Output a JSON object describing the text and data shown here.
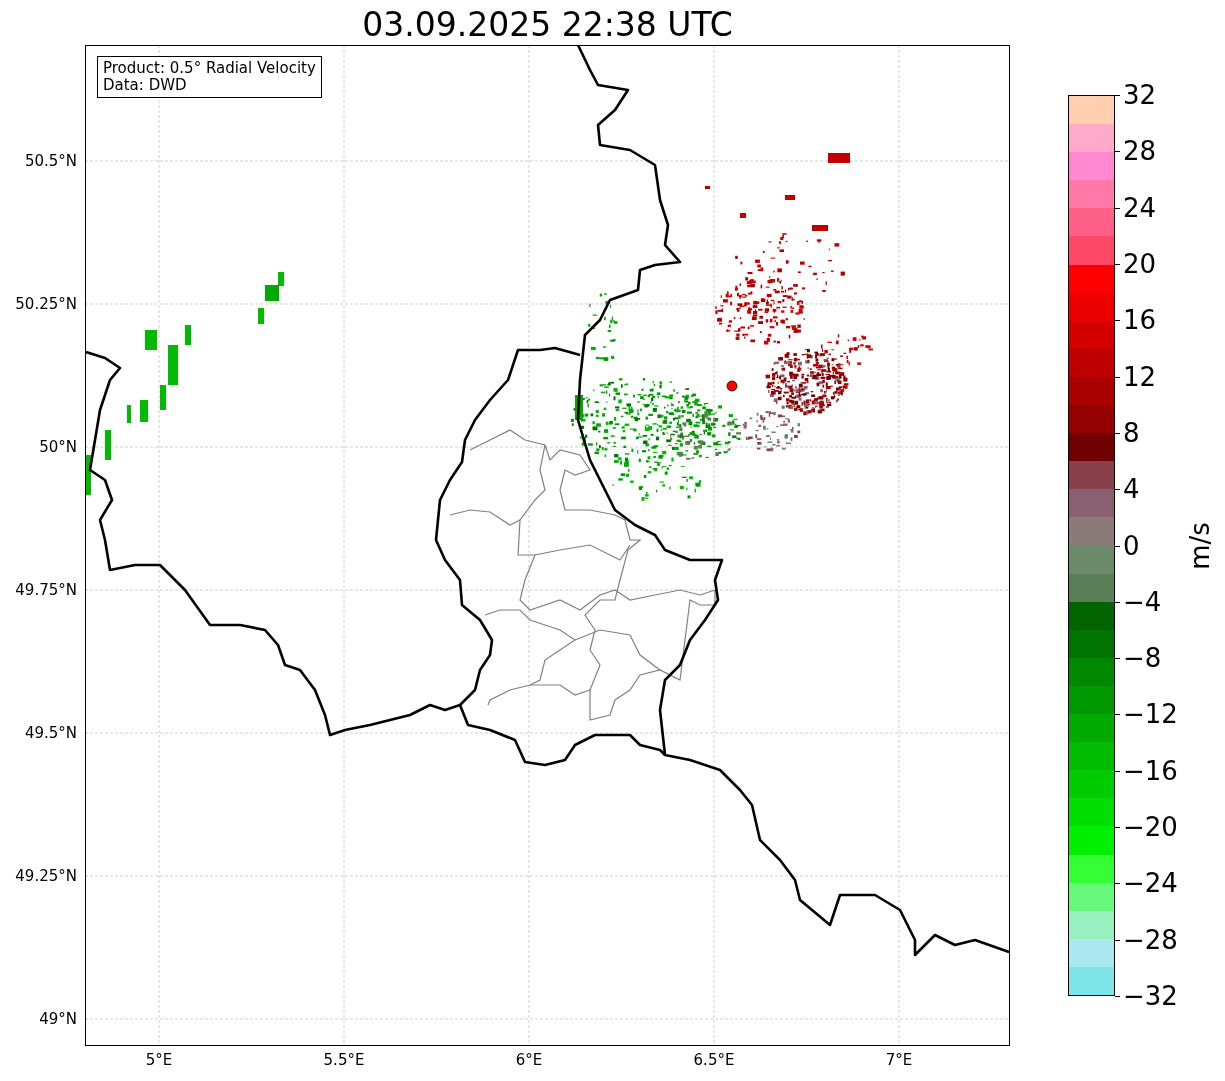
{
  "title": "03.09.2025 22:38 UTC",
  "map": {
    "info_box": [
      "Product: 0.5° Radial Velocity",
      "Data: DWD"
    ],
    "x_ticks": [
      "5°E",
      "5.5°E",
      "6°E",
      "6.5°E",
      "7°E"
    ],
    "y_ticks": [
      "50.5°N",
      "50.25°N",
      "50°N",
      "49.75°N",
      "49.5°N",
      "49.25°N",
      "49°N"
    ]
  },
  "colorbar": {
    "label": "m/s",
    "ticks": [
      "32",
      "28",
      "24",
      "20",
      "16",
      "12",
      "8",
      "4",
      "0",
      "−4",
      "−8",
      "−12",
      "−16",
      "−20",
      "−24",
      "−28",
      "−32"
    ],
    "segments": [
      {
        "color": "#ffcfb0"
      },
      {
        "color": "#ffaac8"
      },
      {
        "color": "#ff88d0"
      },
      {
        "color": "#ff78a8"
      },
      {
        "color": "#ff6088"
      },
      {
        "color": "#ff4868"
      },
      {
        "color": "#ff0000"
      },
      {
        "color": "#ee0000"
      },
      {
        "color": "#d40000"
      },
      {
        "color": "#c00000"
      },
      {
        "color": "#aa0000"
      },
      {
        "color": "#950000"
      },
      {
        "color": "#700000"
      },
      {
        "color": "#884048"
      },
      {
        "color": "#886070"
      },
      {
        "color": "#8a7a78"
      },
      {
        "color": "#6a8a6a"
      },
      {
        "color": "#5a7e58"
      },
      {
        "color": "#006400"
      },
      {
        "color": "#007400"
      },
      {
        "color": "#008800"
      },
      {
        "color": "#009800"
      },
      {
        "color": "#00aa00"
      },
      {
        "color": "#00bb00"
      },
      {
        "color": "#00cc00"
      },
      {
        "color": "#00dd00"
      },
      {
        "color": "#00f000"
      },
      {
        "color": "#33ff33"
      },
      {
        "color": "#66f97a"
      },
      {
        "color": "#99f0c0"
      },
      {
        "color": "#a8e8ee"
      },
      {
        "color": "#7de5e8"
      }
    ]
  }
}
